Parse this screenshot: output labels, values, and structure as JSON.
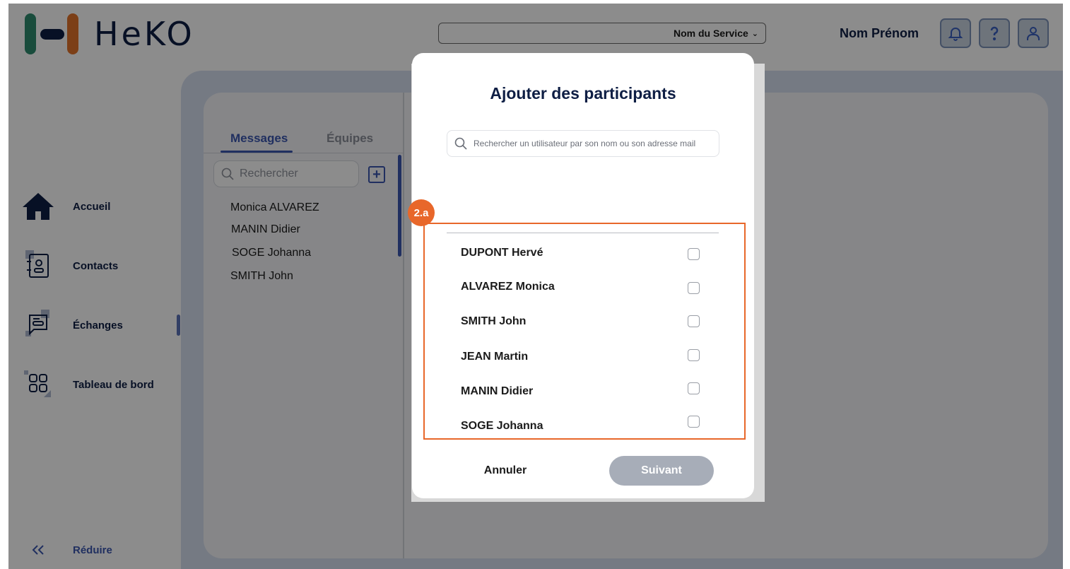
{
  "app": {
    "logo_text": "HeKO"
  },
  "header": {
    "service_select": "Nom du Service",
    "user_name": "Nom Prénom",
    "icons": [
      "bell-icon",
      "help-icon",
      "user-icon"
    ]
  },
  "sidebar": {
    "items": [
      {
        "label": "Accueil",
        "icon": "home-icon"
      },
      {
        "label": "Contacts",
        "icon": "contacts-icon"
      },
      {
        "label": "Échanges",
        "icon": "chat-icon",
        "active": true
      },
      {
        "label": "Tableau de bord",
        "icon": "dashboard-icon"
      }
    ],
    "collapse_label": "Réduire"
  },
  "conversations": {
    "tabs": {
      "messages": "Messages",
      "teams": "Équipes"
    },
    "search_placeholder": "Rechercher",
    "items": [
      "Monica ALVAREZ",
      "MANIN Didier",
      "SOGE Johanna",
      "SMITH John"
    ]
  },
  "modal": {
    "title": "Ajouter des participants",
    "search_placeholder": "Rechercher un utilisateur par son nom ou son adresse mail",
    "badge": "2.a",
    "participants": [
      "DUPONT Hervé",
      "ALVAREZ Monica",
      "SMITH John",
      "JEAN Martin",
      "MANIN Didier",
      "SOGE Johanna"
    ],
    "cancel_label": "Annuler",
    "next_label": "Suivant"
  },
  "colors": {
    "accent": "#3b57b0",
    "highlight": "#e8672a",
    "brand_green": "#2e8b6e",
    "brand_orange": "#e2742a",
    "brand_navy": "#0e1e44"
  }
}
